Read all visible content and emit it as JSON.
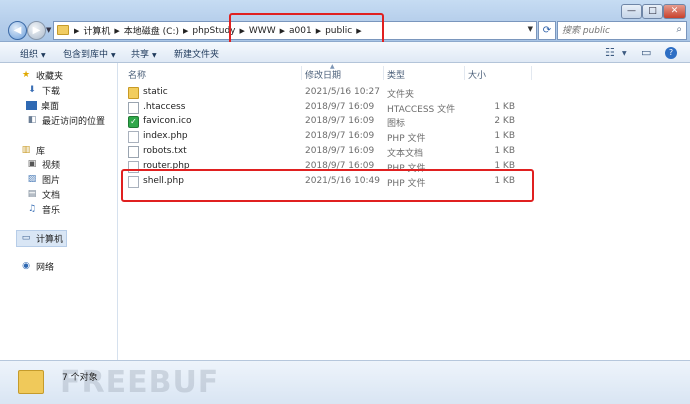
{
  "window": {
    "controls": {
      "minimize": "—",
      "maximize": "□",
      "close": "✕"
    }
  },
  "address": {
    "crumbs": [
      "计算机",
      "本地磁盘 (C:)",
      "phpStudy",
      "WWW",
      "a001",
      "public"
    ],
    "search_placeholder": "搜索 public"
  },
  "toolbar": {
    "organize": "组织",
    "include": "包含到库中",
    "share": "共享",
    "new_folder": "新建文件夹"
  },
  "nav": {
    "favorites": "收藏夹",
    "downloads": "下载",
    "desktop": "桌面",
    "recent": "最近访问的位置",
    "libraries": "库",
    "videos": "视频",
    "pictures": "图片",
    "documents": "文档",
    "music": "音乐",
    "computer": "计算机",
    "network": "网络"
  },
  "columns": {
    "name": "名称",
    "date": "修改日期",
    "type": "类型",
    "size": "大小"
  },
  "files": [
    {
      "name": "static",
      "date": "2021/5/16 10:27",
      "type": "文件夹",
      "size": "",
      "icon": "folder-icon"
    },
    {
      "name": ".htaccess",
      "date": "2018/9/7 16:09",
      "type": "HTACCESS 文件",
      "size": "1 KB",
      "icon": "document-icon"
    },
    {
      "name": "favicon.ico",
      "date": "2018/9/7 16:09",
      "type": "图标",
      "size": "2 KB",
      "icon": "ico-file-icon"
    },
    {
      "name": "index.php",
      "date": "2018/9/7 16:09",
      "type": "PHP 文件",
      "size": "1 KB",
      "icon": "php-file-icon"
    },
    {
      "name": "robots.txt",
      "date": "2018/9/7 16:09",
      "type": "文本文档",
      "size": "1 KB",
      "icon": "document-icon"
    },
    {
      "name": "router.php",
      "date": "2018/9/7 16:09",
      "type": "PHP 文件",
      "size": "1 KB",
      "icon": "php-file-icon"
    },
    {
      "name": "shell.php",
      "date": "2021/5/16 10:49",
      "type": "PHP 文件",
      "size": "1 KB",
      "icon": "php-file-icon"
    }
  ],
  "status": {
    "count": "7 个对象",
    "watermark": "FREEBUF"
  },
  "colors": {
    "highlight": "#e02020",
    "accent": "#3b6aa6"
  }
}
